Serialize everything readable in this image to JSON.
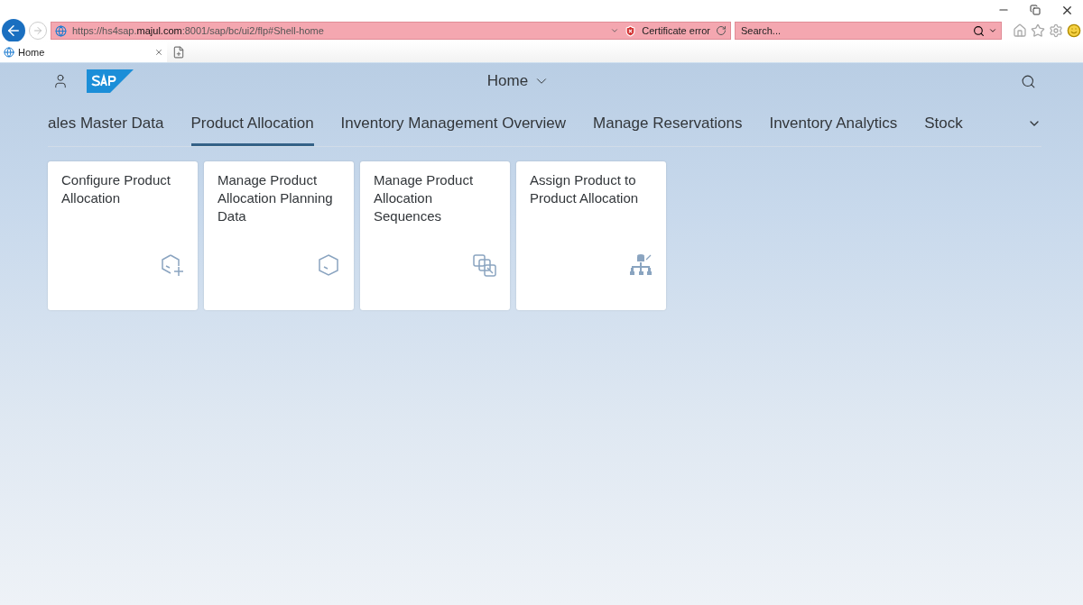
{
  "browser": {
    "address": "https://hs4sap.**majul.com**:8001/sap/bc/ui2/flp#Shell-home",
    "certificate": "Certificate error",
    "search": {
      "placeholder": "Search..."
    },
    "tab": "Home"
  },
  "shell": {
    "title": "Home"
  },
  "tabs": [
    {
      "label": "ales Master Data",
      "selected": false
    },
    {
      "label": "Product Allocation",
      "selected": true
    },
    {
      "label": "Inventory Management Overview",
      "selected": false
    },
    {
      "label": "Manage Reservations",
      "selected": false
    },
    {
      "label": "Inventory Analytics",
      "selected": false
    },
    {
      "label": "Stock",
      "selected": false
    }
  ],
  "tiles": [
    {
      "title": "Configure Product Allocation",
      "kind": "cube-add"
    },
    {
      "title": "Manage Product Allocation Planning Data",
      "kind": "cube"
    },
    {
      "title": "Manage Product Allocation Sequences",
      "kind": "cubes"
    },
    {
      "title": "Assign Product to Product Allocation",
      "kind": "hierarchy"
    }
  ]
}
